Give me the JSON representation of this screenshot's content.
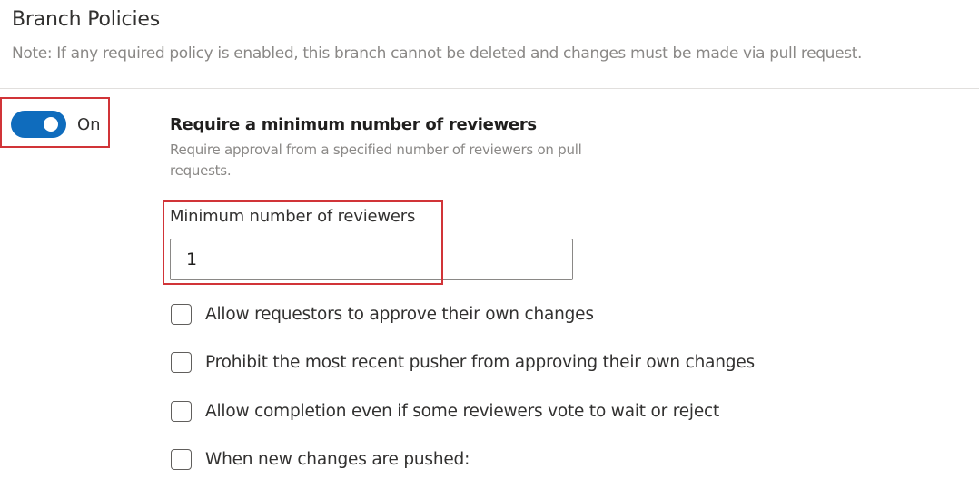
{
  "header": {
    "title": "Branch Policies",
    "note": "Note: If any required policy is enabled, this branch cannot be deleted and changes must be made via pull request."
  },
  "policy": {
    "toggle_state": "On",
    "toggle_on": true,
    "title": "Require a minimum number of reviewers",
    "description": "Require approval from a specified number of reviewers on pull requests.",
    "min_reviewers_label": "Minimum number of reviewers",
    "min_reviewers_value": "1",
    "options": [
      {
        "label": "Allow requestors to approve their own changes",
        "checked": false
      },
      {
        "label": "Prohibit the most recent pusher from approving their own changes",
        "checked": false
      },
      {
        "label": "Allow completion even if some reviewers vote to wait or reject",
        "checked": false
      },
      {
        "label": "When new changes are pushed:",
        "checked": false
      }
    ]
  },
  "colors": {
    "accent": "#0f6cbd",
    "highlight": "#d13438"
  }
}
